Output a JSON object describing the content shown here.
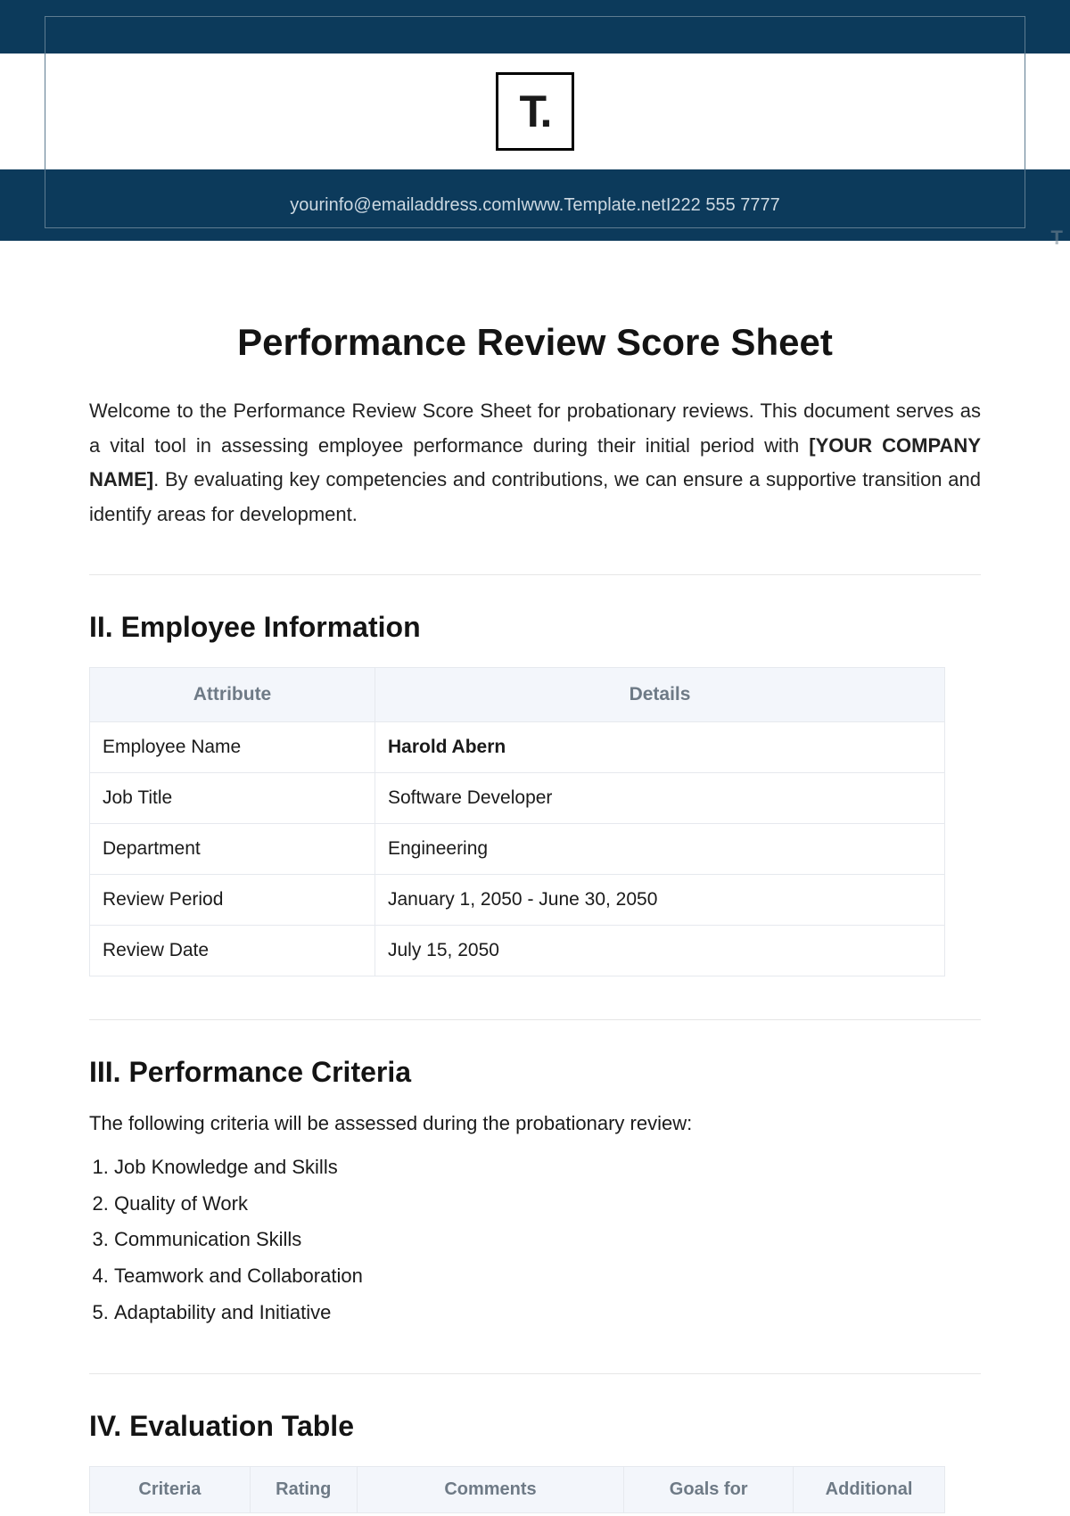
{
  "header": {
    "logo_text": "T.",
    "email": "yourinfo@emailaddress.com",
    "website": "www.Template.net",
    "phone": "222 555 7777",
    "separator": "  I  ",
    "watermark": "T"
  },
  "title": "Performance Review Score Sheet",
  "intro": {
    "part1": "Welcome to the Performance Review Score Sheet for probationary reviews. This document serves as a vital tool in assessing employee performance during their initial period with ",
    "placeholder": "[YOUR COMPANY NAME]",
    "part2": ". By evaluating key competencies and contributions, we can ensure a supportive transition and identify areas for development."
  },
  "employee_section": {
    "heading": "II. Employee Information",
    "columns": {
      "attribute": "Attribute",
      "details": "Details"
    },
    "rows": [
      {
        "attr": "Employee Name",
        "detail": "Harold Abern",
        "bold": true
      },
      {
        "attr": "Job Title",
        "detail": "Software Developer",
        "bold": false
      },
      {
        "attr": "Department",
        "detail": "Engineering",
        "bold": false
      },
      {
        "attr": "Review Period",
        "detail": "January 1, 2050 - June 30, 2050",
        "bold": false
      },
      {
        "attr": "Review Date",
        "detail": "July 15, 2050",
        "bold": false
      }
    ]
  },
  "criteria_section": {
    "heading": "III. Performance Criteria",
    "intro": "The following criteria will be assessed during the probationary review:",
    "items": [
      "Job Knowledge and Skills",
      "Quality of Work",
      "Communication Skills",
      "Teamwork and Collaboration",
      "Adaptability and Initiative"
    ]
  },
  "eval_section": {
    "heading": "IV. Evaluation Table",
    "columns": [
      "Criteria",
      "Rating",
      "Comments",
      "Goals for",
      "Additional"
    ]
  }
}
